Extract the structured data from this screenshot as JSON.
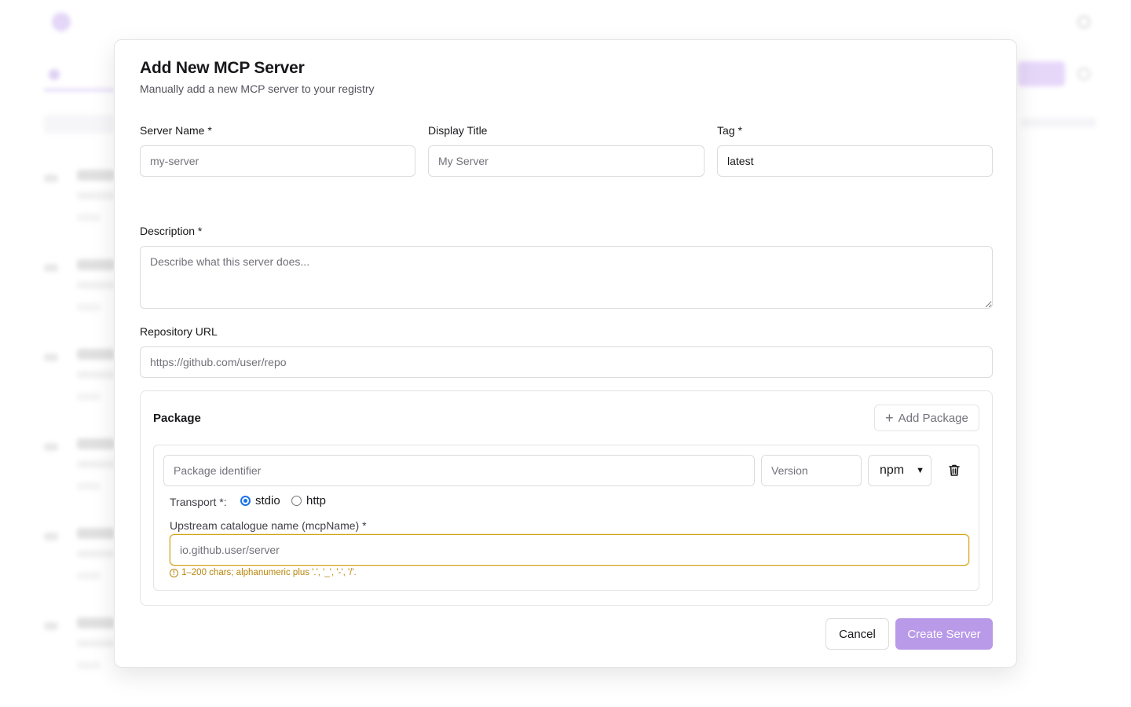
{
  "modal": {
    "title": "Add New MCP Server",
    "subtitle": "Manually add a new MCP server to your registry"
  },
  "fields": {
    "server_name": {
      "label": "Server Name *",
      "placeholder": "my-server",
      "value": ""
    },
    "display_title": {
      "label": "Display Title",
      "placeholder": "My Server",
      "value": ""
    },
    "tag": {
      "label": "Tag *",
      "placeholder": "",
      "value": "latest"
    },
    "description": {
      "label": "Description *",
      "placeholder": "Describe what this server does...",
      "value": ""
    },
    "repository_url": {
      "label": "Repository URL",
      "placeholder": "https://github.com/user/repo",
      "value": ""
    }
  },
  "package": {
    "title": "Package",
    "add_button_label": "Add Package",
    "identifier_placeholder": "Package identifier",
    "version_placeholder": "Version",
    "registry_selected": "npm",
    "transport_label": "Transport *:",
    "transport_options": [
      "stdio",
      "http"
    ],
    "transport_selected": "stdio",
    "mcp_name_label": "Upstream catalogue name (mcpName) *",
    "mcp_name_placeholder": "io.github.user/server",
    "mcp_name_hint": "1–200 chars; alphanumeric plus '.', '_', '-', '/'."
  },
  "actions": {
    "cancel_label": "Cancel",
    "create_label": "Create Server"
  },
  "colors": {
    "accent": "#b99ae8",
    "warning": "#d4a51a",
    "radio_selected": "#1a73e8"
  },
  "icons": {
    "add": "plus-icon",
    "delete": "trash-icon",
    "hint": "info-circle-icon",
    "select": "chevron-down-icon"
  }
}
